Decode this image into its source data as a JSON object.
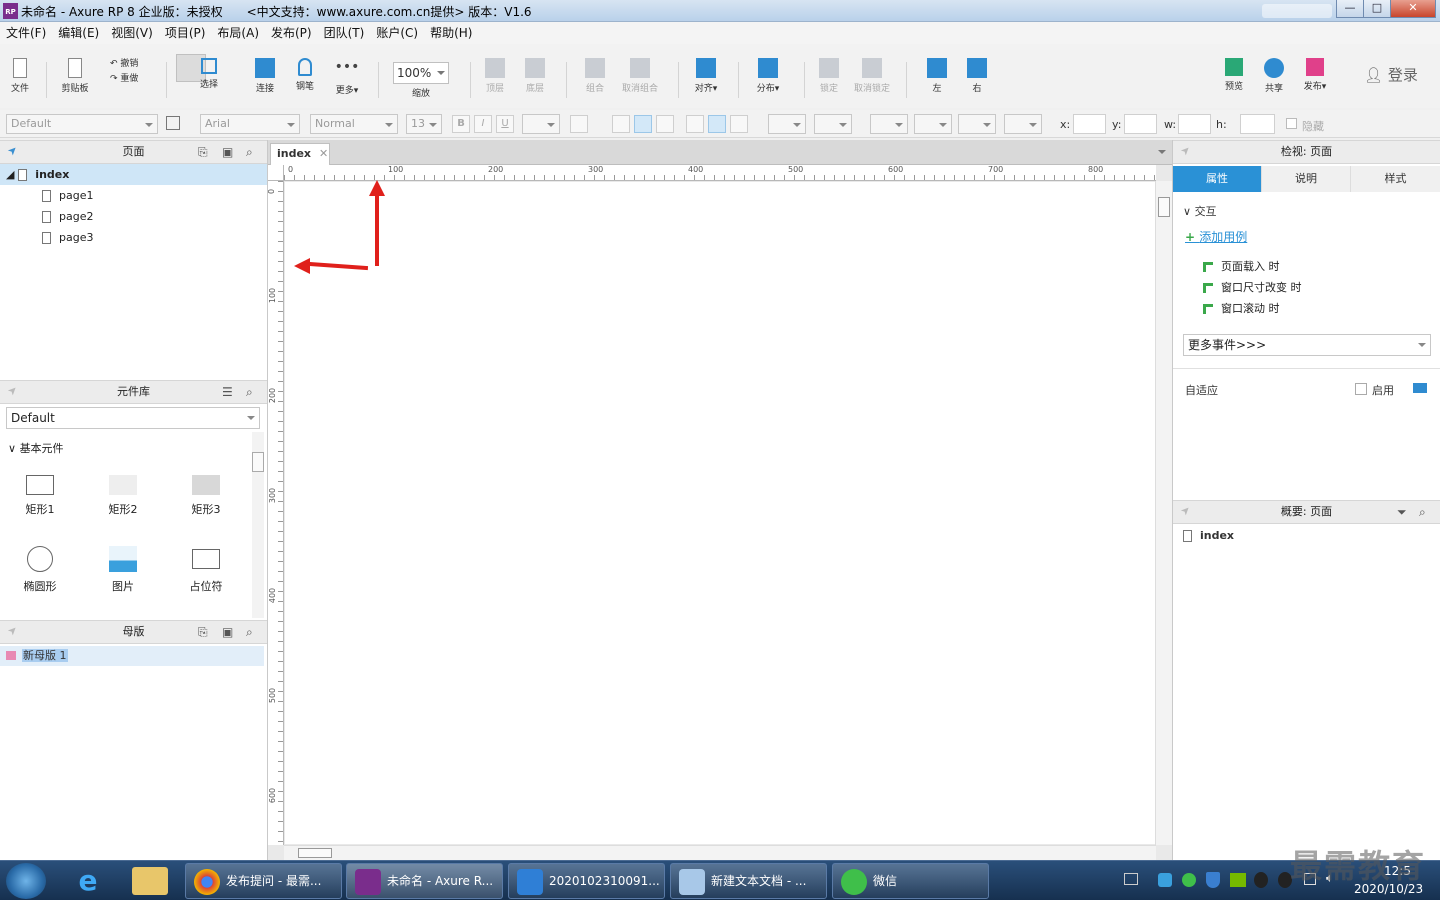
{
  "window": {
    "title": "未命名 - Axure RP 8 企业版：未授权　　<中文支持：www.axure.com.cn提供> 版本：V1.6",
    "min": "—",
    "max": "□",
    "close": "✕"
  },
  "menu": [
    "文件(F)",
    "编辑(E)",
    "视图(V)",
    "项目(P)",
    "布局(A)",
    "发布(P)",
    "团队(T)",
    "账户(C)",
    "帮助(H)"
  ],
  "toolbar": {
    "file": "文件",
    "clipboard": "剪贴板",
    "undo": "撤销",
    "redo": "重做",
    "select": "选择",
    "connect": "连接",
    "pen": "钢笔",
    "more": "更多▾",
    "zoom_value": "100%",
    "zoom_label": "缩放",
    "top": "顶层",
    "bottom": "底层",
    "group": "组合",
    "ungroup": "取消组合",
    "align": "对齐▾",
    "distribute": "分布▾",
    "lock": "锁定",
    "unlock": "取消锁定",
    "left": "左",
    "right": "右",
    "preview": "预览",
    "share": "共享",
    "publish": "发布▾",
    "login": "登录"
  },
  "format": {
    "style": "Default",
    "font": "Arial",
    "weight": "Normal",
    "size": "13",
    "x_label": "x:",
    "y_label": "y:",
    "w_label": "w:",
    "h_label": "h:",
    "hide_label": "隐藏"
  },
  "pages_panel": {
    "title": "页面",
    "root": "index",
    "children": [
      "page1",
      "page2",
      "page3"
    ]
  },
  "library_panel": {
    "title": "元件库",
    "selected": "Default",
    "category": "基本元件",
    "widgets": [
      "矩形1",
      "矩形2",
      "矩形3",
      "椭圆形",
      "图片",
      "占位符"
    ]
  },
  "masters_panel": {
    "title": "母版",
    "items": [
      "新母版 1"
    ]
  },
  "canvas": {
    "tab": "index",
    "hticks": [
      "0",
      "100",
      "200",
      "300",
      "400",
      "500",
      "600",
      "700",
      "800"
    ],
    "vticks": [
      "0",
      "100",
      "200",
      "300",
      "400",
      "500",
      "600"
    ]
  },
  "inspector": {
    "title": "检视: 页面",
    "tabs": [
      "属性",
      "说明",
      "样式"
    ],
    "section": "交互",
    "add_case": "添加用例",
    "events": [
      "页面载入 时",
      "窗口尺寸改变 时",
      "窗口滚动 时"
    ],
    "more_events": "更多事件>>>",
    "adaptive": "自适应",
    "enable": "启用"
  },
  "outline": {
    "title": "概要: 页面",
    "item": "index"
  },
  "taskbar": {
    "items": [
      "发布提问 - 最需...",
      "未命名 - Axure R...",
      "2020102310091...",
      "新建文本文档 - ...",
      "微信"
    ],
    "time": "12:5",
    "date": "2020/10/23"
  },
  "watermark": "最需教育",
  "colors": {
    "accent": "#2a91d6",
    "arrow": "#e0201b",
    "selected_row": "#cfe6f7"
  }
}
